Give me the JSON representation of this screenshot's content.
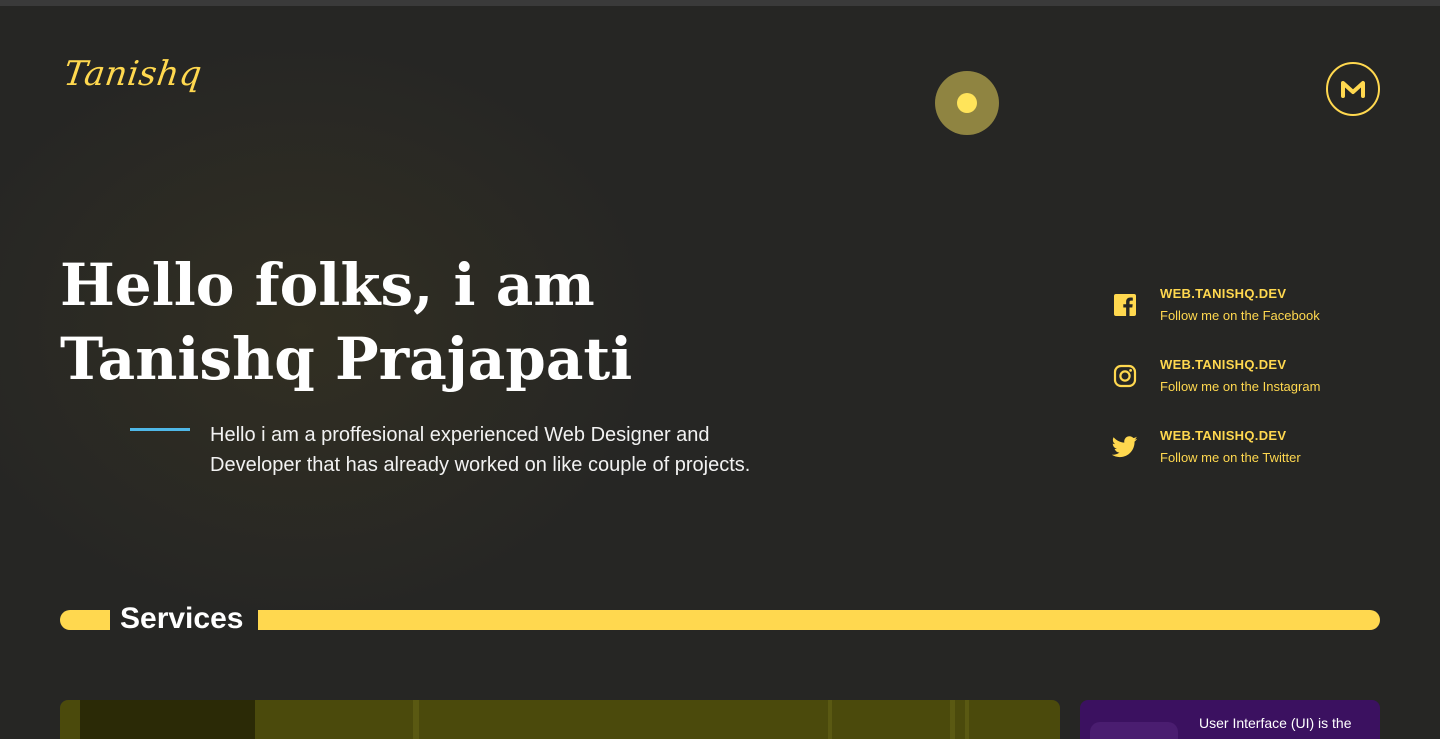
{
  "header": {
    "logo_text": "Tanishq",
    "theme_toggle_icon": "sun-toggle-icon",
    "menu_icon": "m-logo-icon"
  },
  "hero": {
    "title_line1": "Hello folks, i am",
    "title_line2": "Tanishq Prajapati",
    "description": "Hello i am a proffesional experienced Web Designer and Developer that has already worked on like couple of projects."
  },
  "socials": [
    {
      "icon": "facebook-icon",
      "handle": "WEB.TANISHQ.DEV",
      "text": "Follow me on the Facebook"
    },
    {
      "icon": "instagram-icon",
      "handle": "WEB.TANISHQ.DEV",
      "text": "Follow me on the Instagram"
    },
    {
      "icon": "twitter-icon",
      "handle": "WEB.TANISHQ.DEV",
      "text": "Follow me on the Twitter"
    }
  ],
  "services": {
    "heading": "Services",
    "side_card_text": "User Interface (UI) is the"
  },
  "colors": {
    "background": "#262624",
    "accent": "#ffd84f",
    "line_accent": "#4fb8e8",
    "card_olive": "#4b4a0c",
    "card_purple": "#3b1160"
  }
}
